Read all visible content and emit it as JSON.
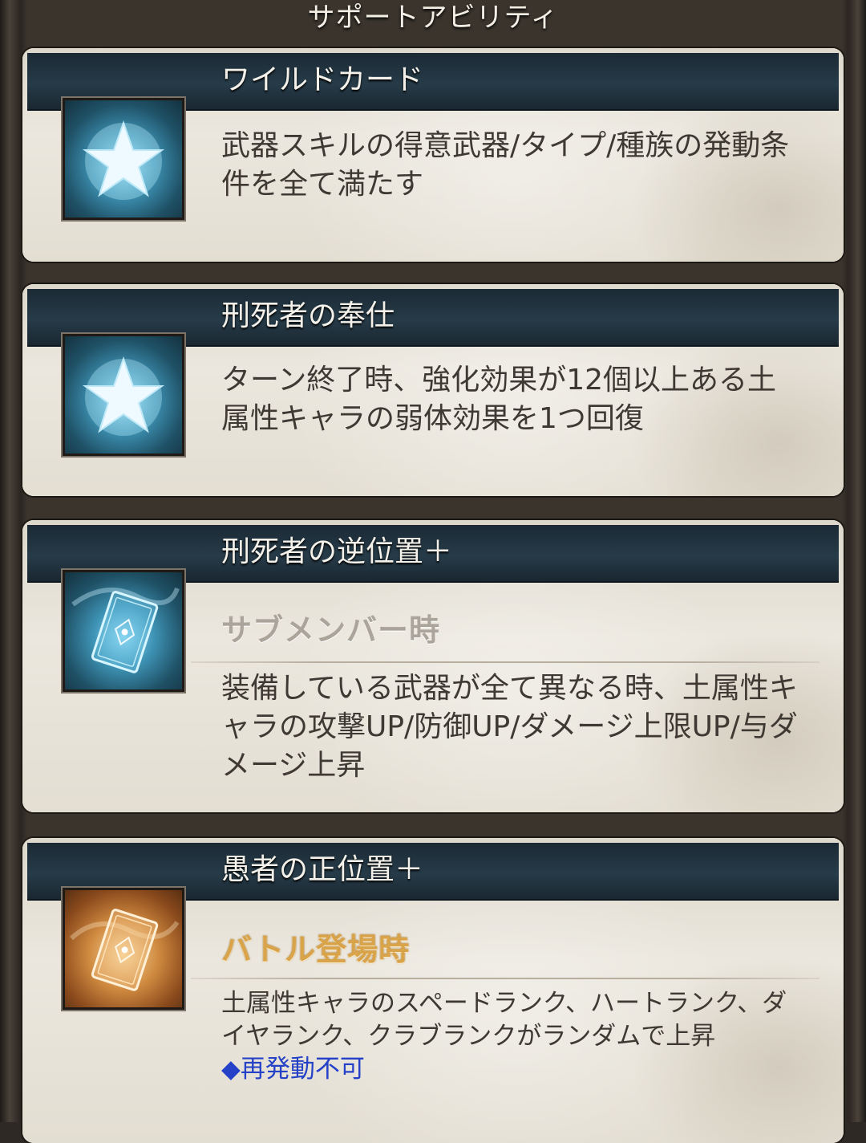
{
  "section_title": "サポートアビリティ",
  "abilities": [
    {
      "name": "ワイルドカード",
      "icon": "star-icon",
      "description": "武器スキルの得意武器/タイプ/種族の発動条件を全て満たす"
    },
    {
      "name": "刑死者の奉仕",
      "icon": "star-icon",
      "description": "ターン終了時、強化効果が12個以上ある土属性キャラの弱体効果を1つ回復"
    },
    {
      "name": "刑死者の逆位置＋",
      "icon": "card-icon",
      "condition": "サブメンバー時",
      "description": "装備している武器が全て異なる時、土属性キャラの攻撃UP/防御UP/ダメージ上限UP/与ダメージ上昇"
    },
    {
      "name": "愚者の正位置＋",
      "icon": "card-icon",
      "condition": "バトル登場時",
      "description": "土属性キャラのスペードランク、ハートランク、ダイヤランク、クラブランクがランダムで上昇",
      "note": "◆再発動不可"
    }
  ],
  "colors": {
    "header_bg": "#1f3140",
    "card_bg": "#e9e4d9",
    "condition_grey": "#aaa49b",
    "condition_gold": "#d9a34a",
    "note_blue": "#2541c8",
    "icon_blue": "#3e93b5",
    "icon_orange": "#d08a40"
  }
}
